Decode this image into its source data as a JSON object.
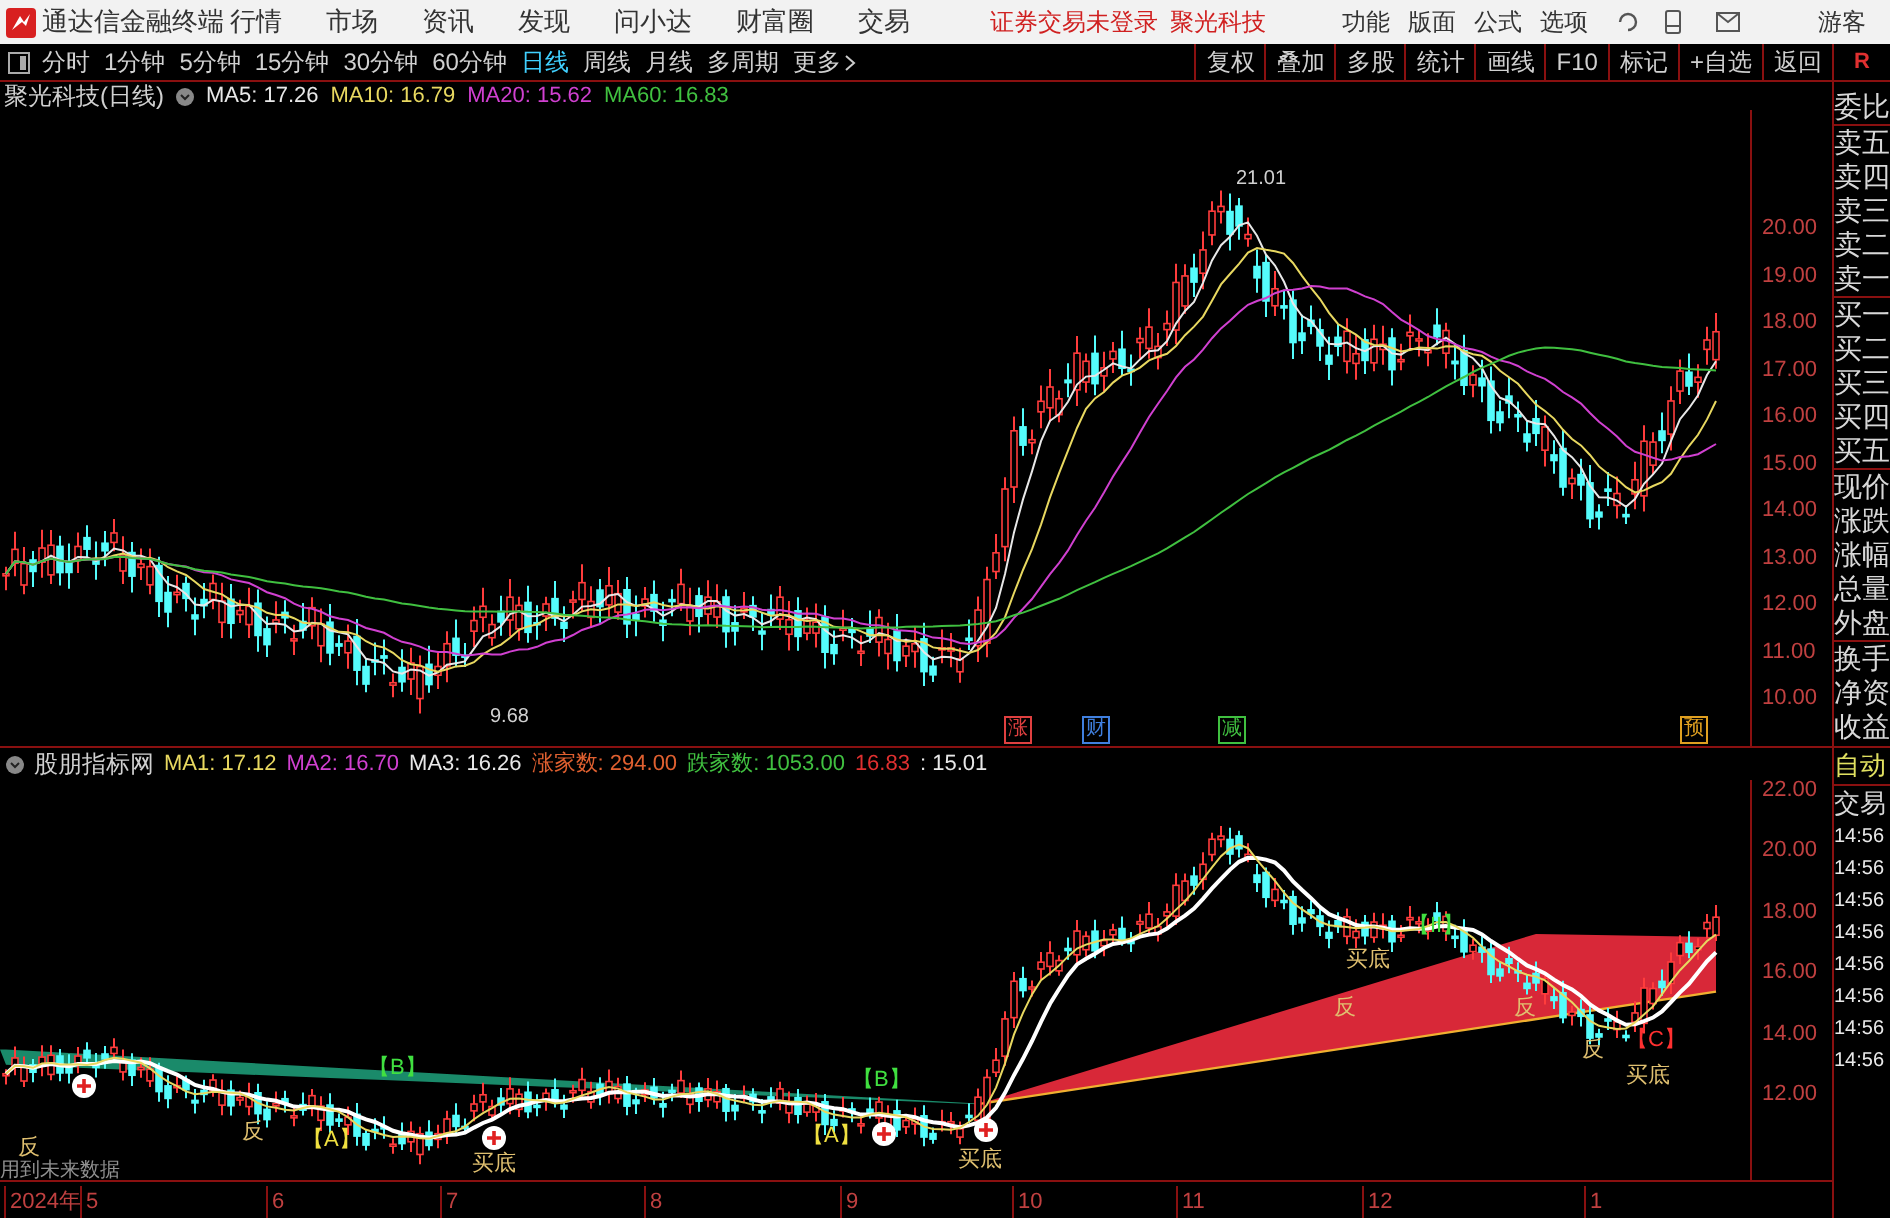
{
  "menubar": {
    "app_name": "通达信金融终端",
    "menus": [
      "行情",
      "市场",
      "资讯",
      "发现",
      "问小达",
      "财富圈",
      "交易"
    ],
    "status": "证券交易未登录",
    "stock": "聚光科技",
    "right_menus": [
      "功能",
      "版面",
      "公式",
      "选项"
    ],
    "user": "游客"
  },
  "period_tabs": [
    {
      "label": "分时",
      "selected": false
    },
    {
      "label": "1分钟",
      "selected": false
    },
    {
      "label": "5分钟",
      "selected": false
    },
    {
      "label": "15分钟",
      "selected": false
    },
    {
      "label": "30分钟",
      "selected": false
    },
    {
      "label": "60分钟",
      "selected": false
    },
    {
      "label": "日线",
      "selected": true
    },
    {
      "label": "周线",
      "selected": false
    },
    {
      "label": "月线",
      "selected": false
    },
    {
      "label": "多周期",
      "selected": false
    },
    {
      "label": "更多",
      "selected": false
    }
  ],
  "tool_buttons": [
    "复权",
    "叠加",
    "多股",
    "统计",
    "画线",
    "F10",
    "标记",
    "+自选",
    "返回"
  ],
  "r_button": "R",
  "main_chart": {
    "title": "聚光科技(日线)",
    "indicators": [
      {
        "label": "MA5: 17.26",
        "color": "#e8e8e8"
      },
      {
        "label": "MA10: 16.79",
        "color": "#e8d860"
      },
      {
        "label": "MA20: 15.62",
        "color": "#d040d0"
      },
      {
        "label": "MA60: 16.83",
        "color": "#40c040"
      }
    ],
    "price_axis": [
      "20.00",
      "19.00",
      "18.00",
      "17.00",
      "16.00",
      "15.00",
      "14.00",
      "13.00",
      "12.00",
      "11.00",
      "10.00"
    ],
    "high_label": "21.01",
    "low_label": "9.68",
    "event_marks": [
      {
        "label": "涨",
        "color": "#e04040"
      },
      {
        "label": "财",
        "color": "#4080e0"
      },
      {
        "label": "减",
        "color": "#40c040"
      },
      {
        "label": "预",
        "color": "#e0a020"
      }
    ]
  },
  "indicator_chart": {
    "title": "股朋指标网",
    "values": [
      {
        "label": "MA1: 17.12",
        "color": "#e8d860"
      },
      {
        "label": "MA2: 16.70",
        "color": "#d040d0"
      },
      {
        "label": "MA3: 16.26",
        "color": "#e8e8e8"
      },
      {
        "label": "涨家数: 294.00",
        "color": "#e06030"
      },
      {
        "label": "跌家数: 1053.00",
        "color": "#40c040"
      },
      {
        "label": "16.83",
        "color": "#e03030"
      },
      {
        "label": ": 15.01",
        "color": "#e8e8e8"
      }
    ],
    "axis": [
      "22.00",
      "20.00",
      "18.00",
      "16.00",
      "14.00",
      "12.00"
    ],
    "signals": [
      {
        "label": "反",
        "color": "#e0c070"
      },
      {
        "label": "【B】",
        "color": "#40e040"
      },
      {
        "label": "反",
        "color": "#e0c070"
      },
      {
        "label": "【A】",
        "color": "#f0e040"
      },
      {
        "label": "买底",
        "color": "#e0c070"
      },
      {
        "label": "【B】",
        "color": "#40e040"
      },
      {
        "label": "【A】",
        "color": "#f0e040"
      },
      {
        "label": "买底",
        "color": "#e0c070"
      },
      {
        "label": "反",
        "color": "#e0c070"
      },
      {
        "label": "买底",
        "color": "#e0c070"
      },
      {
        "label": "【II】",
        "color": "#40e040"
      },
      {
        "label": "反",
        "color": "#e0c070"
      },
      {
        "label": "反",
        "color": "#e0c070"
      },
      {
        "label": "【C】",
        "color": "#ff3030"
      },
      {
        "label": "买底",
        "color": "#e0c070"
      }
    ],
    "note": "用到未来数据"
  },
  "time_axis": [
    "2024年",
    "5",
    "6",
    "7",
    "8",
    "9",
    "10",
    "11",
    "12",
    "1"
  ],
  "quote_panel": [
    "委比",
    "卖五",
    "卖四",
    "卖三",
    "卖二",
    "卖一",
    "买一",
    "买二",
    "买三",
    "买四",
    "买五",
    "现价",
    "涨跌",
    "涨幅",
    "总量",
    "外盘",
    "换手",
    "净资",
    "收益"
  ],
  "trade_panel": {
    "title": "自动",
    "subtitle": "交易",
    "times": [
      "14:56",
      "14:56",
      "14:56",
      "14:56",
      "14:56",
      "14:56",
      "14:56",
      "14:56"
    ]
  }
}
